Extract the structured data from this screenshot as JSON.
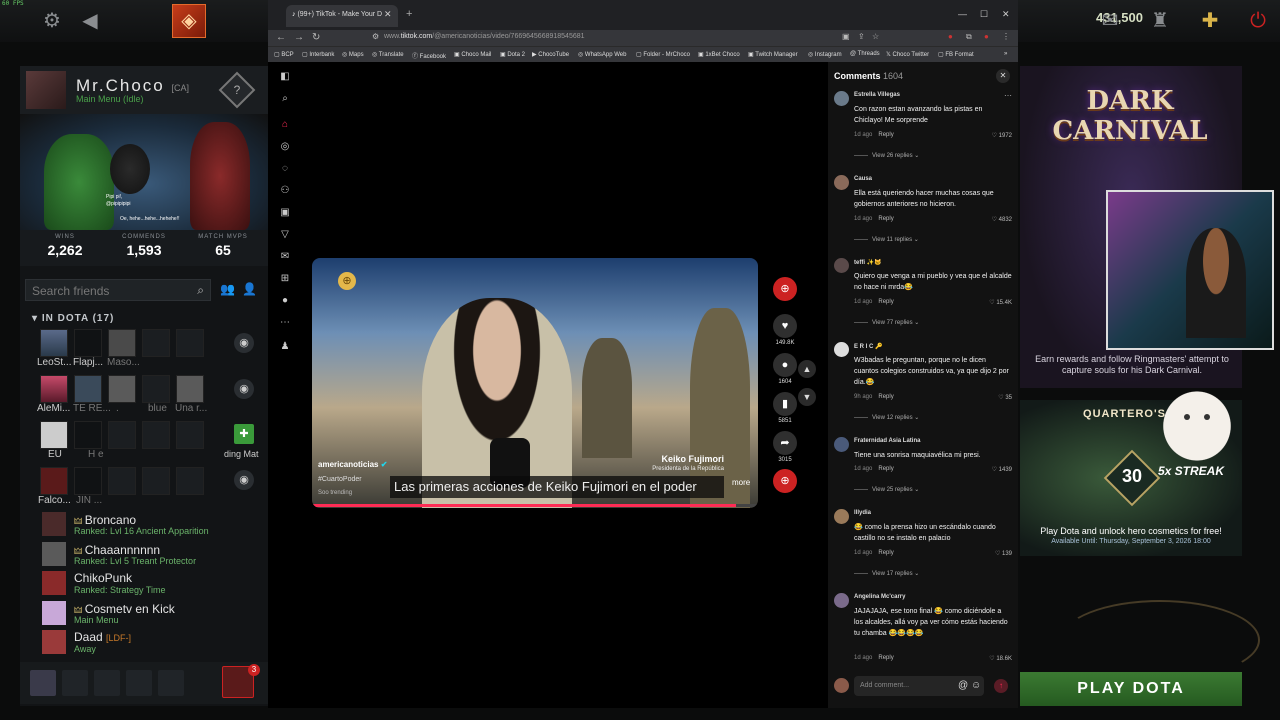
{
  "topbar": {
    "fps": "60 FPS",
    "shards": "431,500",
    "icons": [
      "gear-icon",
      "back-arrow-icon",
      "dota-logo",
      "mail-icon",
      "armory-icon",
      "plus-badge-icon",
      "power-icon"
    ],
    "accent": "#c63d1a"
  },
  "profile": {
    "name": "Mr.Choco",
    "tag": "[CA]",
    "status": "Main Menu (Idle)",
    "rank_icon": "?",
    "stats": [
      {
        "label": "WINS",
        "value": "2,262"
      },
      {
        "label": "COMMENDS",
        "value": "1,593"
      },
      {
        "label": "MATCH MVPS",
        "value": "65"
      }
    ],
    "showcase_text1": "Pipi pi!,",
    "showcase_text2": "@pipipipipi",
    "showcase_text3": "Oe, hehe...hehe...hehehe!!"
  },
  "friends": {
    "search_placeholder": "Search friends",
    "group_label": "IN DOTA",
    "group_count": "(17)",
    "grid_names": [
      "LeoSt...",
      "Flapj...",
      "Maso...",
      "AleMi...",
      "TE RE...",
      ".",
      "blue",
      "Una r...",
      "EU",
      "H  e",
      "ding Mat",
      "Falco...",
      "JIN ..."
    ],
    "list": [
      {
        "name": "Broncano",
        "status": "Ranked: Lvl 16 Ancient Apparition",
        "tag": ""
      },
      {
        "name": "Chaaannnnnn",
        "status": "Ranked: Lvl 5 Treant Protector",
        "tag": ""
      },
      {
        "name": "ChikoPunk",
        "status": "Ranked: Strategy Time",
        "tag": ""
      },
      {
        "name": "Cosmetv en Kick",
        "status": "Main Menu",
        "tag": ""
      },
      {
        "name": "Daad",
        "status": "Away",
        "tag": "[LDF-]"
      }
    ],
    "party_badge": "3"
  },
  "browser": {
    "tab_title": "(99+) TikTok - Make Your D",
    "url_prefix": "www.",
    "url_domain": "tiktok.com",
    "url_path": "/@americanoticias/video/7669645668918545681",
    "bookmarks": [
      "BCP",
      "Interbank",
      "Maps",
      "Translate",
      "Facebook",
      "Choco Mail",
      "Dota 2",
      "ChocoTube",
      "WhatsApp Web",
      "Folder - MrChoco",
      "1xBet Choco",
      "Twitch Manager",
      "Instagram",
      "Threads",
      "Choco Twitter",
      "FB Format"
    ]
  },
  "video": {
    "author": "americanoticias",
    "hashtag": "#CuartoPoder",
    "sound": "Soo trending",
    "lower_third_name": "Keiko Fujimori",
    "lower_third_role": "Presidenta de la República",
    "caption": "Las primeras acciones de Keiko Fujimori en el poder",
    "more": "more",
    "progress_percent": 95,
    "actions": [
      {
        "icon": "heart-icon",
        "count": "149.8K"
      },
      {
        "icon": "comment-icon",
        "count": "1604"
      },
      {
        "icon": "bookmark-icon",
        "count": "5851"
      },
      {
        "icon": "share-icon",
        "count": "3015"
      }
    ]
  },
  "comments": {
    "title": "Comments",
    "count": "1604",
    "input_placeholder": "Add comment...",
    "items": [
      {
        "name": "Estrella Villegas",
        "text": "Con razon estan avanzando las pistas en Chiclayo! Me sorprende",
        "time": "1d ago",
        "reply": "Reply",
        "likes": "1972",
        "view": "View 26 replies",
        "color": "#6a7a8a"
      },
      {
        "name": "Causa",
        "text": "Ella está queriendo hacer muchas cosas que gobiernos anteriores no hicieron.",
        "time": "1d ago",
        "reply": "Reply",
        "likes": "4832",
        "view": "View 11 replies",
        "color": "#8a6a5a"
      },
      {
        "name": "teffi ✨🐱",
        "text": "Quiero que venga a mi pueblo y vea que el alcalde no hace ni mrda😂",
        "time": "1d ago",
        "reply": "Reply",
        "likes": "15.4K",
        "view": "View 77 replies",
        "color": "#5a4a4a"
      },
      {
        "name": "E R I C 🔑",
        "text": "W3badas le preguntan, porque no le dicen cuantos colegios construidos va, ya que dijo 2 por día.😂",
        "time": "9h ago",
        "reply": "Reply",
        "likes": "35",
        "view": "View 12 replies",
        "color": "#ddd"
      },
      {
        "name": "Fraternidad Asia Latina",
        "text": "Tiene una sonrisa maquiavélica mi presi.",
        "time": "1d ago",
        "reply": "Reply",
        "likes": "1439",
        "view": "View 25 replies",
        "color": "#4a5a7a"
      },
      {
        "name": "lllydia",
        "text": "😂 como la prensa hizo un escándalo cuando castillo no se instalo en palacio",
        "time": "1d ago",
        "reply": "Reply",
        "likes": "139",
        "view": "View 17 replies",
        "color": "#9a7a5a"
      },
      {
        "name": "Angelina Mc'carry",
        "text": "JAJAJAJA, ese tono final 😂 como diciéndole a los alcaldes, allá voy pa ver cómo estás haciendo tu chamba 😂😂😂😂",
        "time": "1d ago",
        "reply": "Reply",
        "likes": "18.6K",
        "view": "",
        "color": "#7a6a8a"
      }
    ]
  },
  "event": {
    "title_line1": "DARK",
    "title_line2": "CARNIVAL",
    "text": "Earn rewards and follow Ringmasters' attempt to capture souls for his Dark Carnival."
  },
  "quartero": {
    "title": "QUARTERO'S C",
    "streak_num": "30",
    "streak_label": "5x STREAK",
    "text": "Play Dota and unlock hero cosmetics for free!",
    "date": "Available Until: Thursday, September 3, 2026 18:00"
  },
  "play_button": "PLAY DOTA"
}
